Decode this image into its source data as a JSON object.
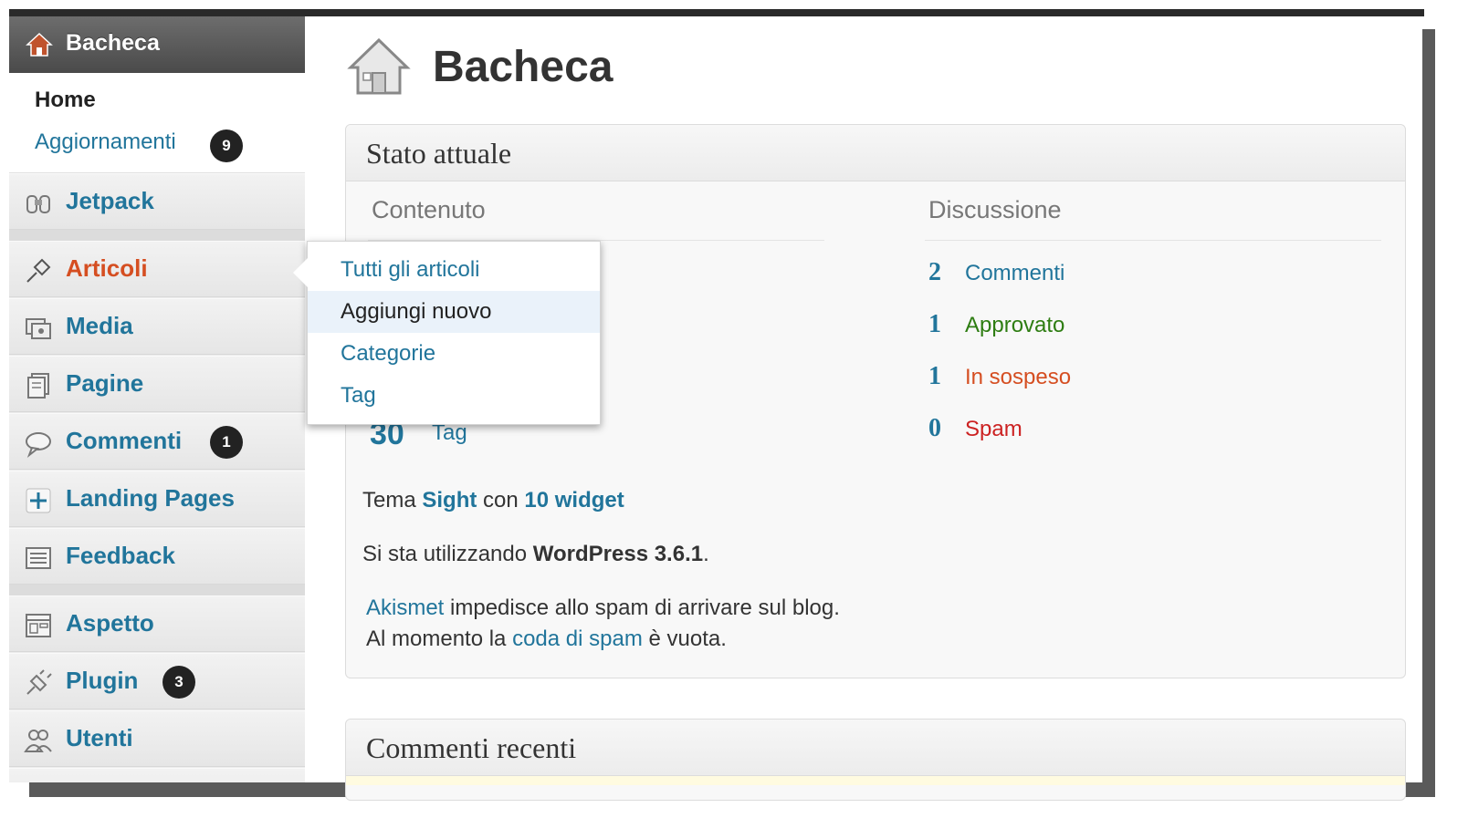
{
  "sidebar": {
    "current": {
      "label": "Bacheca",
      "icon": "home-icon"
    },
    "submenu": {
      "home": "Home",
      "updates": "Aggiornamenti",
      "updates_count": "9"
    },
    "items": [
      {
        "label": "Jetpack",
        "icon": "jetpack-icon"
      },
      {
        "label": "Articoli",
        "icon": "pin-icon",
        "active": true
      },
      {
        "label": "Media",
        "icon": "media-icon"
      },
      {
        "label": "Pagine",
        "icon": "pages-icon"
      },
      {
        "label": "Commenti",
        "icon": "comments-icon",
        "count": "1"
      },
      {
        "label": "Landing Pages",
        "icon": "plus-icon"
      },
      {
        "label": "Feedback",
        "icon": "feedback-icon"
      },
      {
        "label": "Aspetto",
        "icon": "appearance-icon"
      },
      {
        "label": "Plugin",
        "icon": "plugin-icon",
        "count": "3"
      },
      {
        "label": "Utenti",
        "icon": "users-icon"
      }
    ]
  },
  "flyout": {
    "items": [
      "Tutti gli articoli",
      "Aggiungi nuovo",
      "Categorie",
      "Tag"
    ],
    "highlighted_index": 1
  },
  "page": {
    "title": "Bacheca",
    "icon": "home-icon"
  },
  "stato": {
    "title": "Stato attuale",
    "content_heading": "Contenuto",
    "discussion_heading": "Discussione",
    "partial_num": "30",
    "partial_label": "Tag",
    "discussion": [
      {
        "num": "2",
        "label": "Commenti",
        "color": "#21759b"
      },
      {
        "num": "1",
        "label": "Approvato",
        "color": "#2e7d12"
      },
      {
        "num": "1",
        "label": "In sospeso",
        "color": "#d54e21"
      },
      {
        "num": "0",
        "label": "Spam",
        "color": "#cc2222"
      }
    ],
    "theme": {
      "prefix": "Tema ",
      "name": "Sight",
      "mid": " con ",
      "widgets": "10 widget"
    },
    "version": {
      "prefix": "Si sta utilizzando ",
      "name": "WordPress 3.6.1",
      "suffix": "."
    },
    "akismet": {
      "link": "Akismet",
      "line1_rest": " impedisce allo spam di arrivare sul blog.",
      "line2_prefix": "Al momento la ",
      "line2_link": "coda di spam",
      "line2_suffix": " è vuota."
    }
  },
  "recent": {
    "title": "Commenti recenti"
  },
  "colors": {
    "link": "#21759b",
    "active": "#d54e21",
    "sidebar_bg": "#ececec"
  }
}
